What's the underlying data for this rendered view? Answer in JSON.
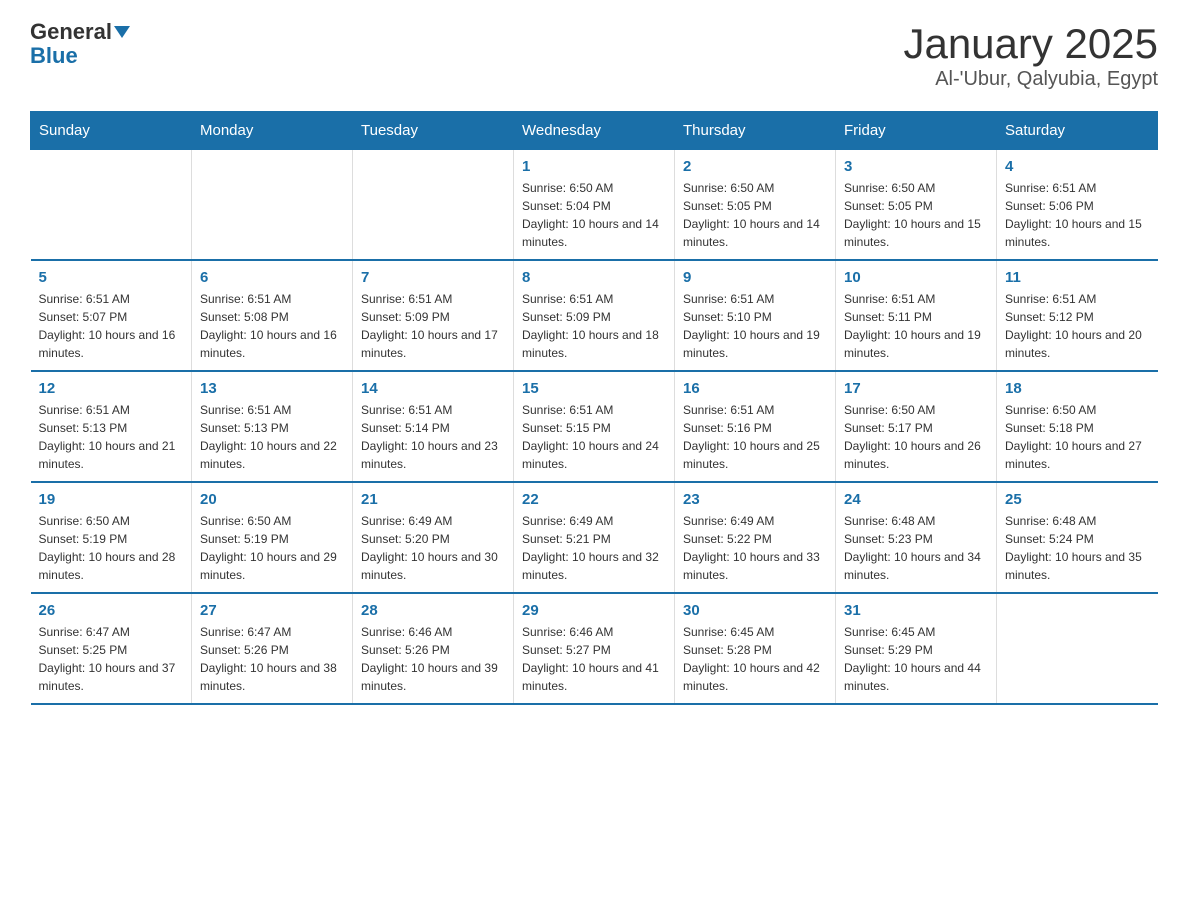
{
  "logo": {
    "general": "General",
    "blue": "Blue"
  },
  "title": "January 2025",
  "subtitle": "Al-'Ubur, Qalyubia, Egypt",
  "days_of_week": [
    "Sunday",
    "Monday",
    "Tuesday",
    "Wednesday",
    "Thursday",
    "Friday",
    "Saturday"
  ],
  "weeks": [
    [
      {
        "day": null
      },
      {
        "day": null
      },
      {
        "day": null
      },
      {
        "day": "1",
        "sunrise": "6:50 AM",
        "sunset": "5:04 PM",
        "daylight": "10 hours and 14 minutes."
      },
      {
        "day": "2",
        "sunrise": "6:50 AM",
        "sunset": "5:05 PM",
        "daylight": "10 hours and 14 minutes."
      },
      {
        "day": "3",
        "sunrise": "6:50 AM",
        "sunset": "5:05 PM",
        "daylight": "10 hours and 15 minutes."
      },
      {
        "day": "4",
        "sunrise": "6:51 AM",
        "sunset": "5:06 PM",
        "daylight": "10 hours and 15 minutes."
      }
    ],
    [
      {
        "day": "5",
        "sunrise": "6:51 AM",
        "sunset": "5:07 PM",
        "daylight": "10 hours and 16 minutes."
      },
      {
        "day": "6",
        "sunrise": "6:51 AM",
        "sunset": "5:08 PM",
        "daylight": "10 hours and 16 minutes."
      },
      {
        "day": "7",
        "sunrise": "6:51 AM",
        "sunset": "5:09 PM",
        "daylight": "10 hours and 17 minutes."
      },
      {
        "day": "8",
        "sunrise": "6:51 AM",
        "sunset": "5:09 PM",
        "daylight": "10 hours and 18 minutes."
      },
      {
        "day": "9",
        "sunrise": "6:51 AM",
        "sunset": "5:10 PM",
        "daylight": "10 hours and 19 minutes."
      },
      {
        "day": "10",
        "sunrise": "6:51 AM",
        "sunset": "5:11 PM",
        "daylight": "10 hours and 19 minutes."
      },
      {
        "day": "11",
        "sunrise": "6:51 AM",
        "sunset": "5:12 PM",
        "daylight": "10 hours and 20 minutes."
      }
    ],
    [
      {
        "day": "12",
        "sunrise": "6:51 AM",
        "sunset": "5:13 PM",
        "daylight": "10 hours and 21 minutes."
      },
      {
        "day": "13",
        "sunrise": "6:51 AM",
        "sunset": "5:13 PM",
        "daylight": "10 hours and 22 minutes."
      },
      {
        "day": "14",
        "sunrise": "6:51 AM",
        "sunset": "5:14 PM",
        "daylight": "10 hours and 23 minutes."
      },
      {
        "day": "15",
        "sunrise": "6:51 AM",
        "sunset": "5:15 PM",
        "daylight": "10 hours and 24 minutes."
      },
      {
        "day": "16",
        "sunrise": "6:51 AM",
        "sunset": "5:16 PM",
        "daylight": "10 hours and 25 minutes."
      },
      {
        "day": "17",
        "sunrise": "6:50 AM",
        "sunset": "5:17 PM",
        "daylight": "10 hours and 26 minutes."
      },
      {
        "day": "18",
        "sunrise": "6:50 AM",
        "sunset": "5:18 PM",
        "daylight": "10 hours and 27 minutes."
      }
    ],
    [
      {
        "day": "19",
        "sunrise": "6:50 AM",
        "sunset": "5:19 PM",
        "daylight": "10 hours and 28 minutes."
      },
      {
        "day": "20",
        "sunrise": "6:50 AM",
        "sunset": "5:19 PM",
        "daylight": "10 hours and 29 minutes."
      },
      {
        "day": "21",
        "sunrise": "6:49 AM",
        "sunset": "5:20 PM",
        "daylight": "10 hours and 30 minutes."
      },
      {
        "day": "22",
        "sunrise": "6:49 AM",
        "sunset": "5:21 PM",
        "daylight": "10 hours and 32 minutes."
      },
      {
        "day": "23",
        "sunrise": "6:49 AM",
        "sunset": "5:22 PM",
        "daylight": "10 hours and 33 minutes."
      },
      {
        "day": "24",
        "sunrise": "6:48 AM",
        "sunset": "5:23 PM",
        "daylight": "10 hours and 34 minutes."
      },
      {
        "day": "25",
        "sunrise": "6:48 AM",
        "sunset": "5:24 PM",
        "daylight": "10 hours and 35 minutes."
      }
    ],
    [
      {
        "day": "26",
        "sunrise": "6:47 AM",
        "sunset": "5:25 PM",
        "daylight": "10 hours and 37 minutes."
      },
      {
        "day": "27",
        "sunrise": "6:47 AM",
        "sunset": "5:26 PM",
        "daylight": "10 hours and 38 minutes."
      },
      {
        "day": "28",
        "sunrise": "6:46 AM",
        "sunset": "5:26 PM",
        "daylight": "10 hours and 39 minutes."
      },
      {
        "day": "29",
        "sunrise": "6:46 AM",
        "sunset": "5:27 PM",
        "daylight": "10 hours and 41 minutes."
      },
      {
        "day": "30",
        "sunrise": "6:45 AM",
        "sunset": "5:28 PM",
        "daylight": "10 hours and 42 minutes."
      },
      {
        "day": "31",
        "sunrise": "6:45 AM",
        "sunset": "5:29 PM",
        "daylight": "10 hours and 44 minutes."
      },
      {
        "day": null
      }
    ]
  ]
}
